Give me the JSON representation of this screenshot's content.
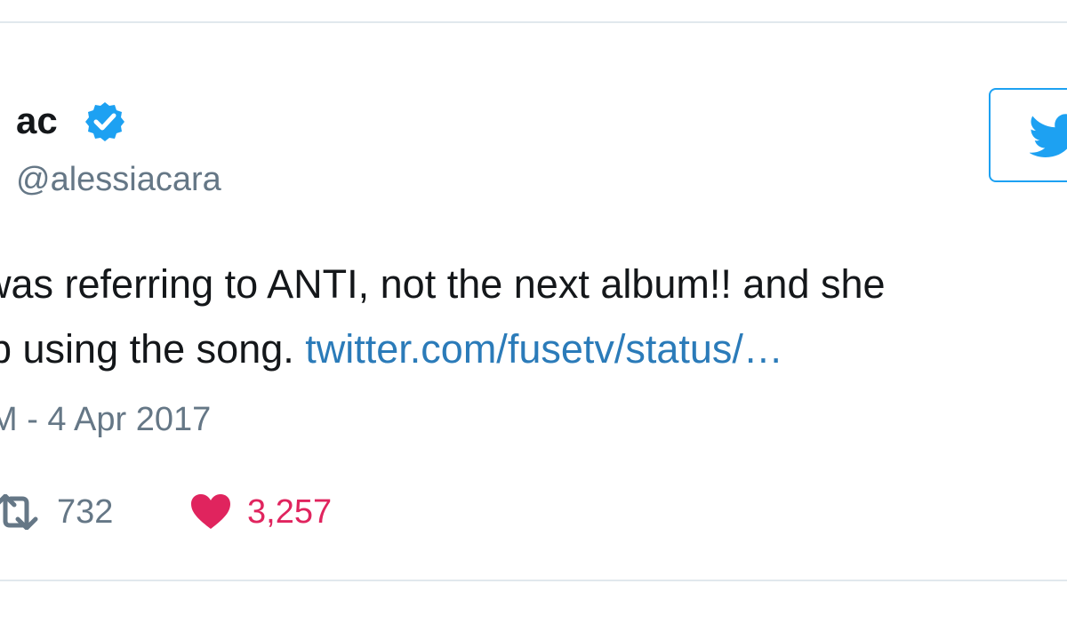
{
  "tweet": {
    "author": {
      "display_name": "ac",
      "handle": "@alessiacara",
      "verified": true
    },
    "text": {
      "line1": "was referring to ANTI, not the next album!! and she",
      "line2_text": "p using the song. ",
      "link": "twitter.com/fusetv/status/…"
    },
    "timestamp": "M - 4 Apr 2017",
    "stats": {
      "retweets": "732",
      "likes": "3,257"
    }
  },
  "colors": {
    "twitter_blue": "#1da1f2",
    "link_blue": "#2b7bb9",
    "like_red": "#e0245e",
    "secondary_text": "#657786",
    "primary_text": "#14171a",
    "border": "#e1e8ed"
  },
  "icons": {
    "verified": "verified-badge-icon",
    "follow_button": "twitter-bird-icon",
    "retweet": "retweet-icon",
    "like": "heart-icon"
  }
}
